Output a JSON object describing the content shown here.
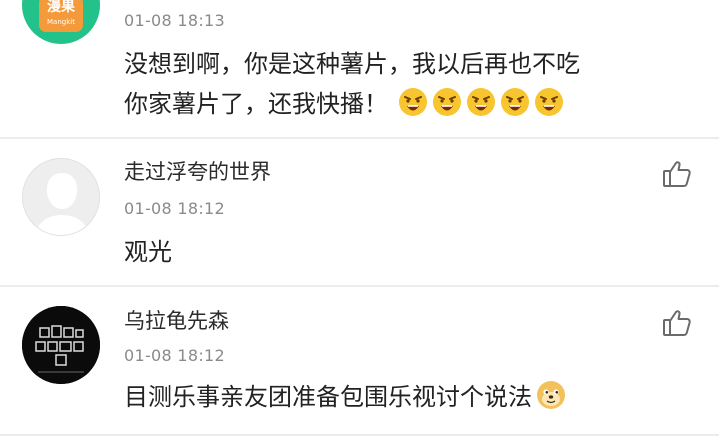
{
  "comments": [
    {
      "avatar_logo_text": "Mangkit",
      "avatar_logo_glyph": "漫果",
      "timestamp": "01-08 18:13",
      "line1": "没想到啊，你是这种薯片，我以后再也不吃",
      "line2": "你家薯片了，还我快播！",
      "emojis": [
        "angry-face-icon",
        "angry-face-icon",
        "angry-face-icon",
        "angry-face-icon",
        "angry-face-icon"
      ]
    },
    {
      "username": "走过浮夸的世界",
      "timestamp": "01-08 18:12",
      "text": "观光"
    },
    {
      "username": "乌拉龟先森",
      "timestamp": "01-08 18:12",
      "text": "目测乐事亲友团准备包围乐视讨个说法",
      "emojis": [
        "doge-face-icon"
      ]
    }
  ],
  "colors": {
    "username": "#2b2b2b",
    "timestamp": "#8a8a8a",
    "content": "#222222",
    "divider": "#ececec",
    "avatar_green": "#22c28a",
    "logo_orange": "#f59a3a",
    "emoji_yellow": "#f7c52f"
  }
}
